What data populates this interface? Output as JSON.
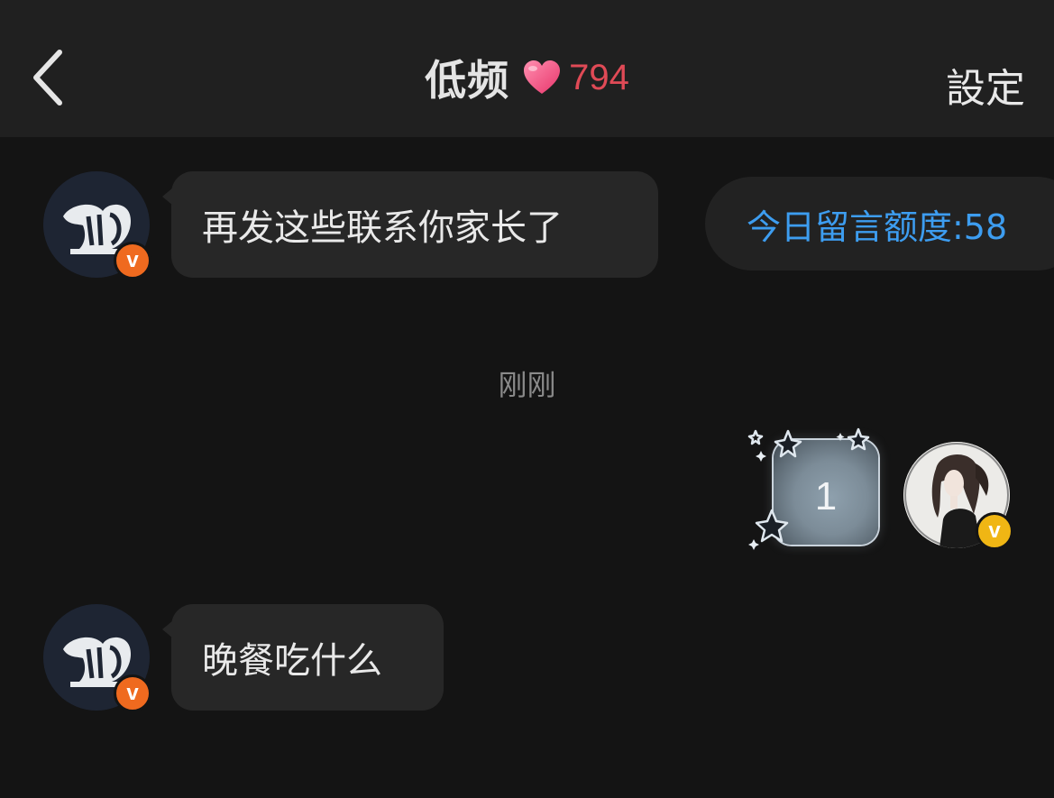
{
  "header": {
    "back_icon": "chevron-left-icon",
    "title": "低频",
    "heart_icon": "heart-icon",
    "heart_count": "794",
    "settings_label": "設定"
  },
  "colors": {
    "background": "#141414",
    "header_bg": "#202020",
    "bubble_bg": "#272727",
    "heart": "#e04a56",
    "quota_text": "#3d9df0",
    "badge_orange": "#ef6a1f",
    "badge_yellow": "#f0b614"
  },
  "quota": {
    "text": "今日留言额度:58"
  },
  "messages": [
    {
      "side": "left",
      "avatar_icon": "logo-avatar",
      "badge": "v",
      "text": "再发这些联系你家长了"
    },
    {
      "type": "timestamp",
      "text": "刚刚"
    },
    {
      "side": "right",
      "avatar_icon": "girl-avatar",
      "badge": "v",
      "sticker_text": "1"
    },
    {
      "side": "left",
      "avatar_icon": "logo-avatar",
      "badge": "v",
      "text": "晚餐吃什么"
    }
  ]
}
